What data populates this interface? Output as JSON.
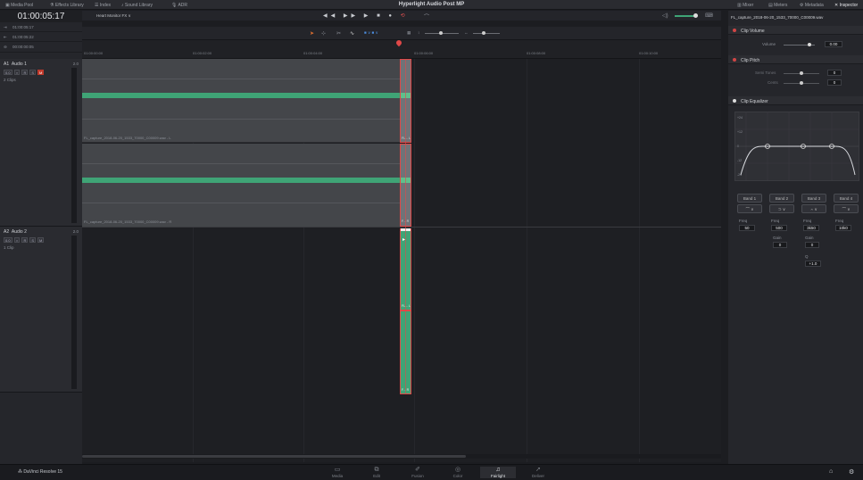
{
  "topbar": {
    "media_pool": "Media Pool",
    "effects_library": "Effects Library",
    "index": "Index",
    "sound_library": "Sound Library",
    "adr": "ADR",
    "project_title": "Hyperlight Audio Post MP",
    "mixer": "Mixer",
    "meters": "Meters",
    "metadata": "Metadata",
    "inspector": "Inspector"
  },
  "timecode": {
    "main": "01:00:05:17",
    "in": "01:00:05:17",
    "out": "01:00:05:22",
    "duration": "00:00:00:05"
  },
  "monitor": "Heart Monitor FX",
  "tracks": [
    {
      "id": "A1",
      "name": "Audio 1",
      "channels": "2.0",
      "volume": "0.0",
      "clips": "2 Clips"
    },
    {
      "id": "A2",
      "name": "Audio 2",
      "channels": "2.0",
      "volume": "0.0",
      "clips": "1 Clip"
    }
  ],
  "ruler_ticks": [
    "01:00:00:00",
    "01:00:02:00",
    "01:00:04:00",
    "01:00:06:00",
    "01:00:08:00",
    "01:00:10:00"
  ],
  "clips": {
    "a1_upper": "FL_capture_2018-06-20_1533_70000_C00009.wav - L",
    "a1_upper_short": "FL... L",
    "a1_lower": "FL_capture_2018-06-20_1533_70000_C00009.wav - R",
    "a1_lower_short": "F... R",
    "a2_upper_short": "FL... L",
    "a2_lower_short": "F... R"
  },
  "inspector": {
    "file": "FL_capture_2018-06-20_1533_70000_C00009.wav",
    "clip_volume": {
      "header": "Clip Volume",
      "label": "Volume",
      "value": "0.00"
    },
    "clip_pitch": {
      "header": "Clip Pitch",
      "semi_label": "Semi Tones",
      "semi_value": "0",
      "cents_label": "Cents",
      "cents_value": "0"
    },
    "clip_equalizer": {
      "header": "Clip Equalizer",
      "db_labels": [
        "+24",
        "+12",
        "0",
        "-12",
        "-24"
      ],
      "bands": [
        {
          "name": "Band 1",
          "freq_label": "Freq",
          "freq": "50"
        },
        {
          "name": "Band 2",
          "freq_label": "Freq",
          "freq": "500",
          "gain_label": "Gain",
          "gain": "0"
        },
        {
          "name": "Band 3",
          "freq_label": "Freq",
          "freq": "3k50",
          "gain_label": "Gain",
          "gain": "0",
          "q_label": "Q",
          "q": "+1.0"
        },
        {
          "name": "Band 4",
          "freq_label": "Freq",
          "freq": "10k0"
        }
      ]
    }
  },
  "app": "DaVinci Resolve 15",
  "pages": [
    {
      "name": "Media",
      "glyph": "▭"
    },
    {
      "name": "Edit",
      "glyph": "⧉"
    },
    {
      "name": "Fusion",
      "glyph": "✐"
    },
    {
      "name": "Color",
      "glyph": "◎"
    },
    {
      "name": "Fairlight",
      "glyph": "♫"
    },
    {
      "name": "Deliver",
      "glyph": "➚"
    }
  ],
  "active_page": "Fairlight",
  "colors": {
    "clip": "#3fa476",
    "clip_bg": "#44464a",
    "playhead": "#e04848",
    "accent": "#d04545"
  }
}
